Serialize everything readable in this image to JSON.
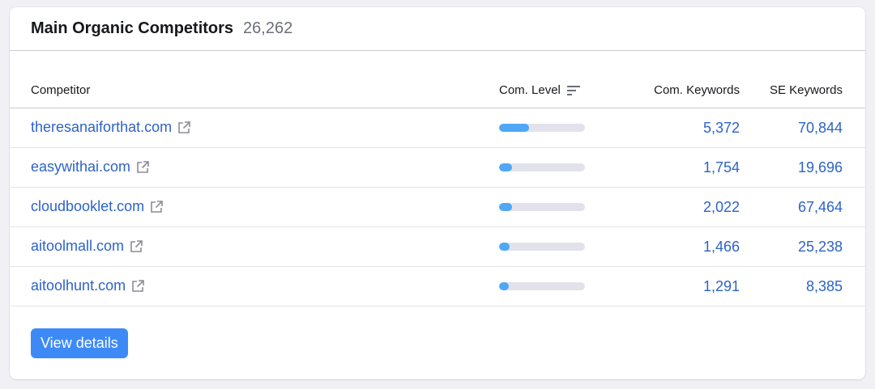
{
  "header": {
    "title": "Main Organic Competitors",
    "count": "26,262"
  },
  "columns": {
    "competitor": "Competitor",
    "com_level": "Com. Level",
    "com_keywords": "Com. Keywords",
    "se_keywords": "SE Keywords"
  },
  "rows": [
    {
      "domain": "theresanaiforthat.com",
      "com_level": 0.35,
      "com_keywords": "5,372",
      "se_keywords": "70,844"
    },
    {
      "domain": "easywithai.com",
      "com_level": 0.15,
      "com_keywords": "1,754",
      "se_keywords": "19,696"
    },
    {
      "domain": "cloudbooklet.com",
      "com_level": 0.15,
      "com_keywords": "2,022",
      "se_keywords": "67,464"
    },
    {
      "domain": "aitoolmall.com",
      "com_level": 0.12,
      "com_keywords": "1,466",
      "se_keywords": "25,238"
    },
    {
      "domain": "aitoolhunt.com",
      "com_level": 0.11,
      "com_keywords": "1,291",
      "se_keywords": "8,385"
    }
  ],
  "actions": {
    "view_details": "View details"
  },
  "colors": {
    "link": "#2d63c8",
    "bar_fill": "#4fa7f5",
    "bar_track": "#e2e3ea",
    "button": "#3d8af7"
  },
  "icons": {
    "external_link": "external-link-icon",
    "sort": "sort-icon"
  }
}
